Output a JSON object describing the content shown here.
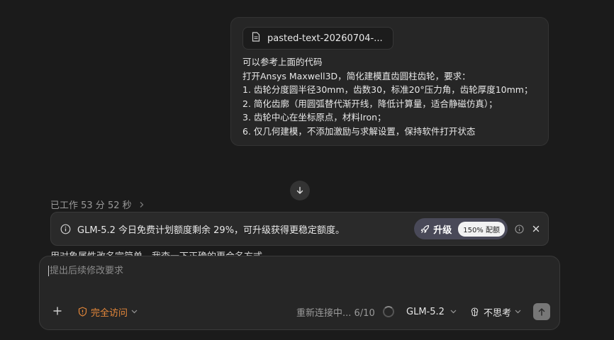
{
  "user_message": {
    "attachment_name": "pasted-text-20260704-...",
    "lines": [
      "可以参考上面的代码",
      "打开Ansys Maxwell3D，简化建模直齿圆柱齿轮，要求：",
      "1. 齿轮分度圆半径30mm，齿数30，标准20°压力角，齿轮厚度10mm；",
      "2. 简化齿廓（用圆弧替代渐开线，降低计算量，适合静磁仿真）；",
      "3. 齿轮中心在坐标原点，材料Iron；",
      "6. 仅几何建模，不添加激励与求解设置，保持软件打开状态"
    ]
  },
  "status": {
    "worked_label": "已工作 53 分 52 秒",
    "partial_text": "用对象属性改名完简单，我查一下正确的更合名方式"
  },
  "banner": {
    "text": "GLM-5.2 今日免费计划额度剩余 29%，可升级获得更稳定额度。",
    "upgrade_label": "升级",
    "quota_pill": "150% 配额"
  },
  "composer": {
    "placeholder": "提出后续修改要求",
    "access_label": "完全访问",
    "reconnect_text": "重新连接中... 6/10",
    "model_label": "GLM-5.2",
    "thinking_label": "不思考"
  },
  "colors": {
    "background": "#1b1b1b",
    "accent_orange": "#e6883a",
    "upgrade_bg": "#494958"
  },
  "icons": [
    "document-icon",
    "arrow-down-icon",
    "chevron-right-icon",
    "info-icon",
    "rocket-icon",
    "close-icon",
    "plus-icon",
    "shield-icon",
    "chevron-down-icon",
    "spinner-icon",
    "brain-icon",
    "arrow-up-icon"
  ]
}
